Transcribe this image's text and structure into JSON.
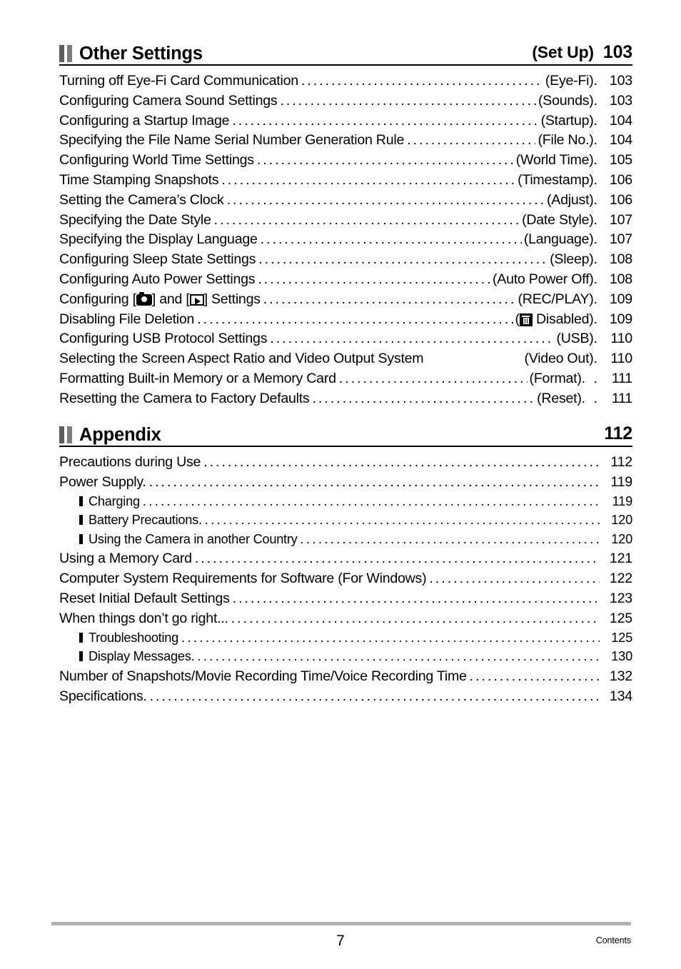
{
  "document": {
    "footer_page_number": "7",
    "footer_label": "Contents"
  },
  "sections": [
    {
      "marker": "section-marker-icon",
      "title": "Other Settings",
      "tag": "(Set Up)",
      "page": "103",
      "entries": [
        {
          "label": "Turning off Eye-Fi Card Communication",
          "tag": "(Eye-Fi)",
          "page": "103",
          "level": 0,
          "leader": "dots",
          "trailing_dots": "."
        },
        {
          "label": "Configuring Camera Sound Settings",
          "tag": "(Sounds)",
          "page": "103",
          "level": 0,
          "leader": "dots",
          "trailing_dots": "."
        },
        {
          "label": "Configuring a Startup Image",
          "tag": "(Startup)",
          "page": "104",
          "level": 0,
          "leader": "dots",
          "trailing_dots": "."
        },
        {
          "label": "Specifying the File Name Serial Number Generation Rule",
          "tag": "(File No.)",
          "page": "104",
          "level": 0,
          "leader": "dots",
          "trailing_dots": "."
        },
        {
          "label": "Configuring World Time Settings",
          "tag": "(World Time)",
          "page": "105",
          "level": 0,
          "leader": "dots",
          "trailing_dots": "."
        },
        {
          "label": "Time Stamping Snapshots",
          "tag": "(Timestamp)",
          "page": "106",
          "level": 0,
          "leader": "dots",
          "trailing_dots": "."
        },
        {
          "label": "Setting the Camera’s Clock",
          "tag": "(Adjust)",
          "page": "106",
          "level": 0,
          "leader": "dots",
          "trailing_dots": "."
        },
        {
          "label": "Specifying the Date Style",
          "tag": "(Date Style)",
          "page": "107",
          "level": 0,
          "leader": "dots",
          "trailing_dots": "."
        },
        {
          "label": "Specifying the Display Language",
          "tag": "(Language)",
          "page": "107",
          "level": 0,
          "leader": "dots",
          "trailing_dots": "."
        },
        {
          "label": "Configuring Sleep State Settings",
          "tag": "(Sleep)",
          "page": "108",
          "level": 0,
          "leader": "dots",
          "trailing_dots": "."
        },
        {
          "label": "Configuring Auto Power Settings",
          "tag": "(Auto Power Off)",
          "page": "108",
          "level": 0,
          "leader": "dots",
          "trailing_dots": "."
        },
        {
          "label_pre": "Configuring [",
          "icon_1": "camera-icon",
          "label_mid": "] and [",
          "icon_2": "playback-icon",
          "label_post": "] Settings",
          "tag": "(REC/PLAY)",
          "page": "109",
          "level": 0,
          "leader": "dots",
          "trailing_dots": ".",
          "has_icons": true
        },
        {
          "label": "Disabling File Deletion",
          "tag_pre": "(",
          "icon_1": "trash-icon",
          "tag_post": " Disabled)",
          "page": "109",
          "level": 0,
          "leader": "dots",
          "trailing_dots": ".",
          "has_icons": true
        },
        {
          "label": "Configuring USB Protocol Settings",
          "tag": "(USB)",
          "page": "110",
          "level": 0,
          "leader": "dots",
          "trailing_dots": "."
        },
        {
          "label": "Selecting the Screen Aspect Ratio and Video Output System",
          "tag": "(Video Out)",
          "page": "110",
          "level": 0,
          "leader": "none",
          "trailing_dots": "."
        },
        {
          "label": "Formatting Built-in Memory or a Memory Card",
          "tag": "(Format)",
          "page": "111",
          "level": 0,
          "leader": "dots",
          "trailing_dots": ". ."
        },
        {
          "label": "Resetting the Camera to Factory Defaults",
          "tag": "(Reset)",
          "page": "111",
          "level": 0,
          "leader": "dots",
          "trailing_dots": ". ."
        }
      ]
    },
    {
      "marker": "section-marker-icon",
      "title": "Appendix",
      "tag": "",
      "page": "112",
      "entries": [
        {
          "label": "Precautions during Use",
          "tag": "",
          "page": "112",
          "level": 0,
          "leader": "dots",
          "trailing_dots": ""
        },
        {
          "label": "Power Supply.",
          "tag": "",
          "page": "119",
          "level": 0,
          "leader": "dots",
          "trailing_dots": ""
        },
        {
          "label": "Charging",
          "tag": "",
          "page": "119",
          "level": 1,
          "leader": "dots",
          "trailing_dots": ""
        },
        {
          "label": "Battery Precautions.",
          "tag": "",
          "page": "120",
          "level": 1,
          "leader": "dots",
          "trailing_dots": ""
        },
        {
          "label": "Using the Camera in another Country",
          "tag": "",
          "page": "120",
          "level": 1,
          "leader": "dots",
          "trailing_dots": ""
        },
        {
          "label": "Using a Memory Card",
          "tag": "",
          "page": "121",
          "level": 0,
          "leader": "dots",
          "trailing_dots": ""
        },
        {
          "label": "Computer System Requirements for Software (For Windows)",
          "tag": "",
          "page": "122",
          "level": 0,
          "leader": "dots",
          "trailing_dots": ""
        },
        {
          "label": "Reset Initial Default Settings",
          "tag": "",
          "page": "123",
          "level": 0,
          "leader": "dots",
          "trailing_dots": ""
        },
        {
          "label": "When things don’t go right...",
          "tag": "",
          "page": "125",
          "level": 0,
          "leader": "dots",
          "trailing_dots": ""
        },
        {
          "label": "Troubleshooting",
          "tag": "",
          "page": "125",
          "level": 1,
          "leader": "dots",
          "trailing_dots": ""
        },
        {
          "label": "Display Messages.",
          "tag": "",
          "page": "130",
          "level": 1,
          "leader": "dots",
          "trailing_dots": ""
        },
        {
          "label": "Number of Snapshots/Movie Recording Time/Voice Recording Time",
          "tag": "",
          "page": "132",
          "level": 0,
          "leader": "dots",
          "trailing_dots": ""
        },
        {
          "label": "Specifications.",
          "tag": "",
          "page": "134",
          "level": 0,
          "leader": "dots",
          "trailing_dots": ""
        }
      ]
    }
  ]
}
